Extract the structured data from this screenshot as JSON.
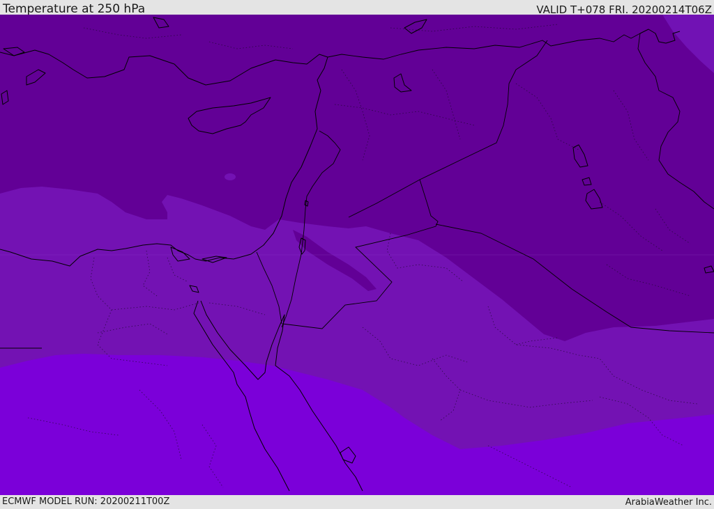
{
  "header": {
    "title": "Temperature at 250 hPa",
    "valid": "VALID T+078 FRI. 20200214T06Z"
  },
  "footer": {
    "model_run": "ECMWF MODEL RUN: 20200211T00Z",
    "credit": "ArabiaWeather Inc."
  },
  "map": {
    "parameter": "Temperature",
    "level_hpa": 250,
    "colors": {
      "coldest_band": "#620096",
      "middle_band": "#7312b3",
      "warmest_band": "#7b00d9",
      "northeast_patch": "#7112b4",
      "coastline": "#000000",
      "borders": "#000000"
    }
  }
}
